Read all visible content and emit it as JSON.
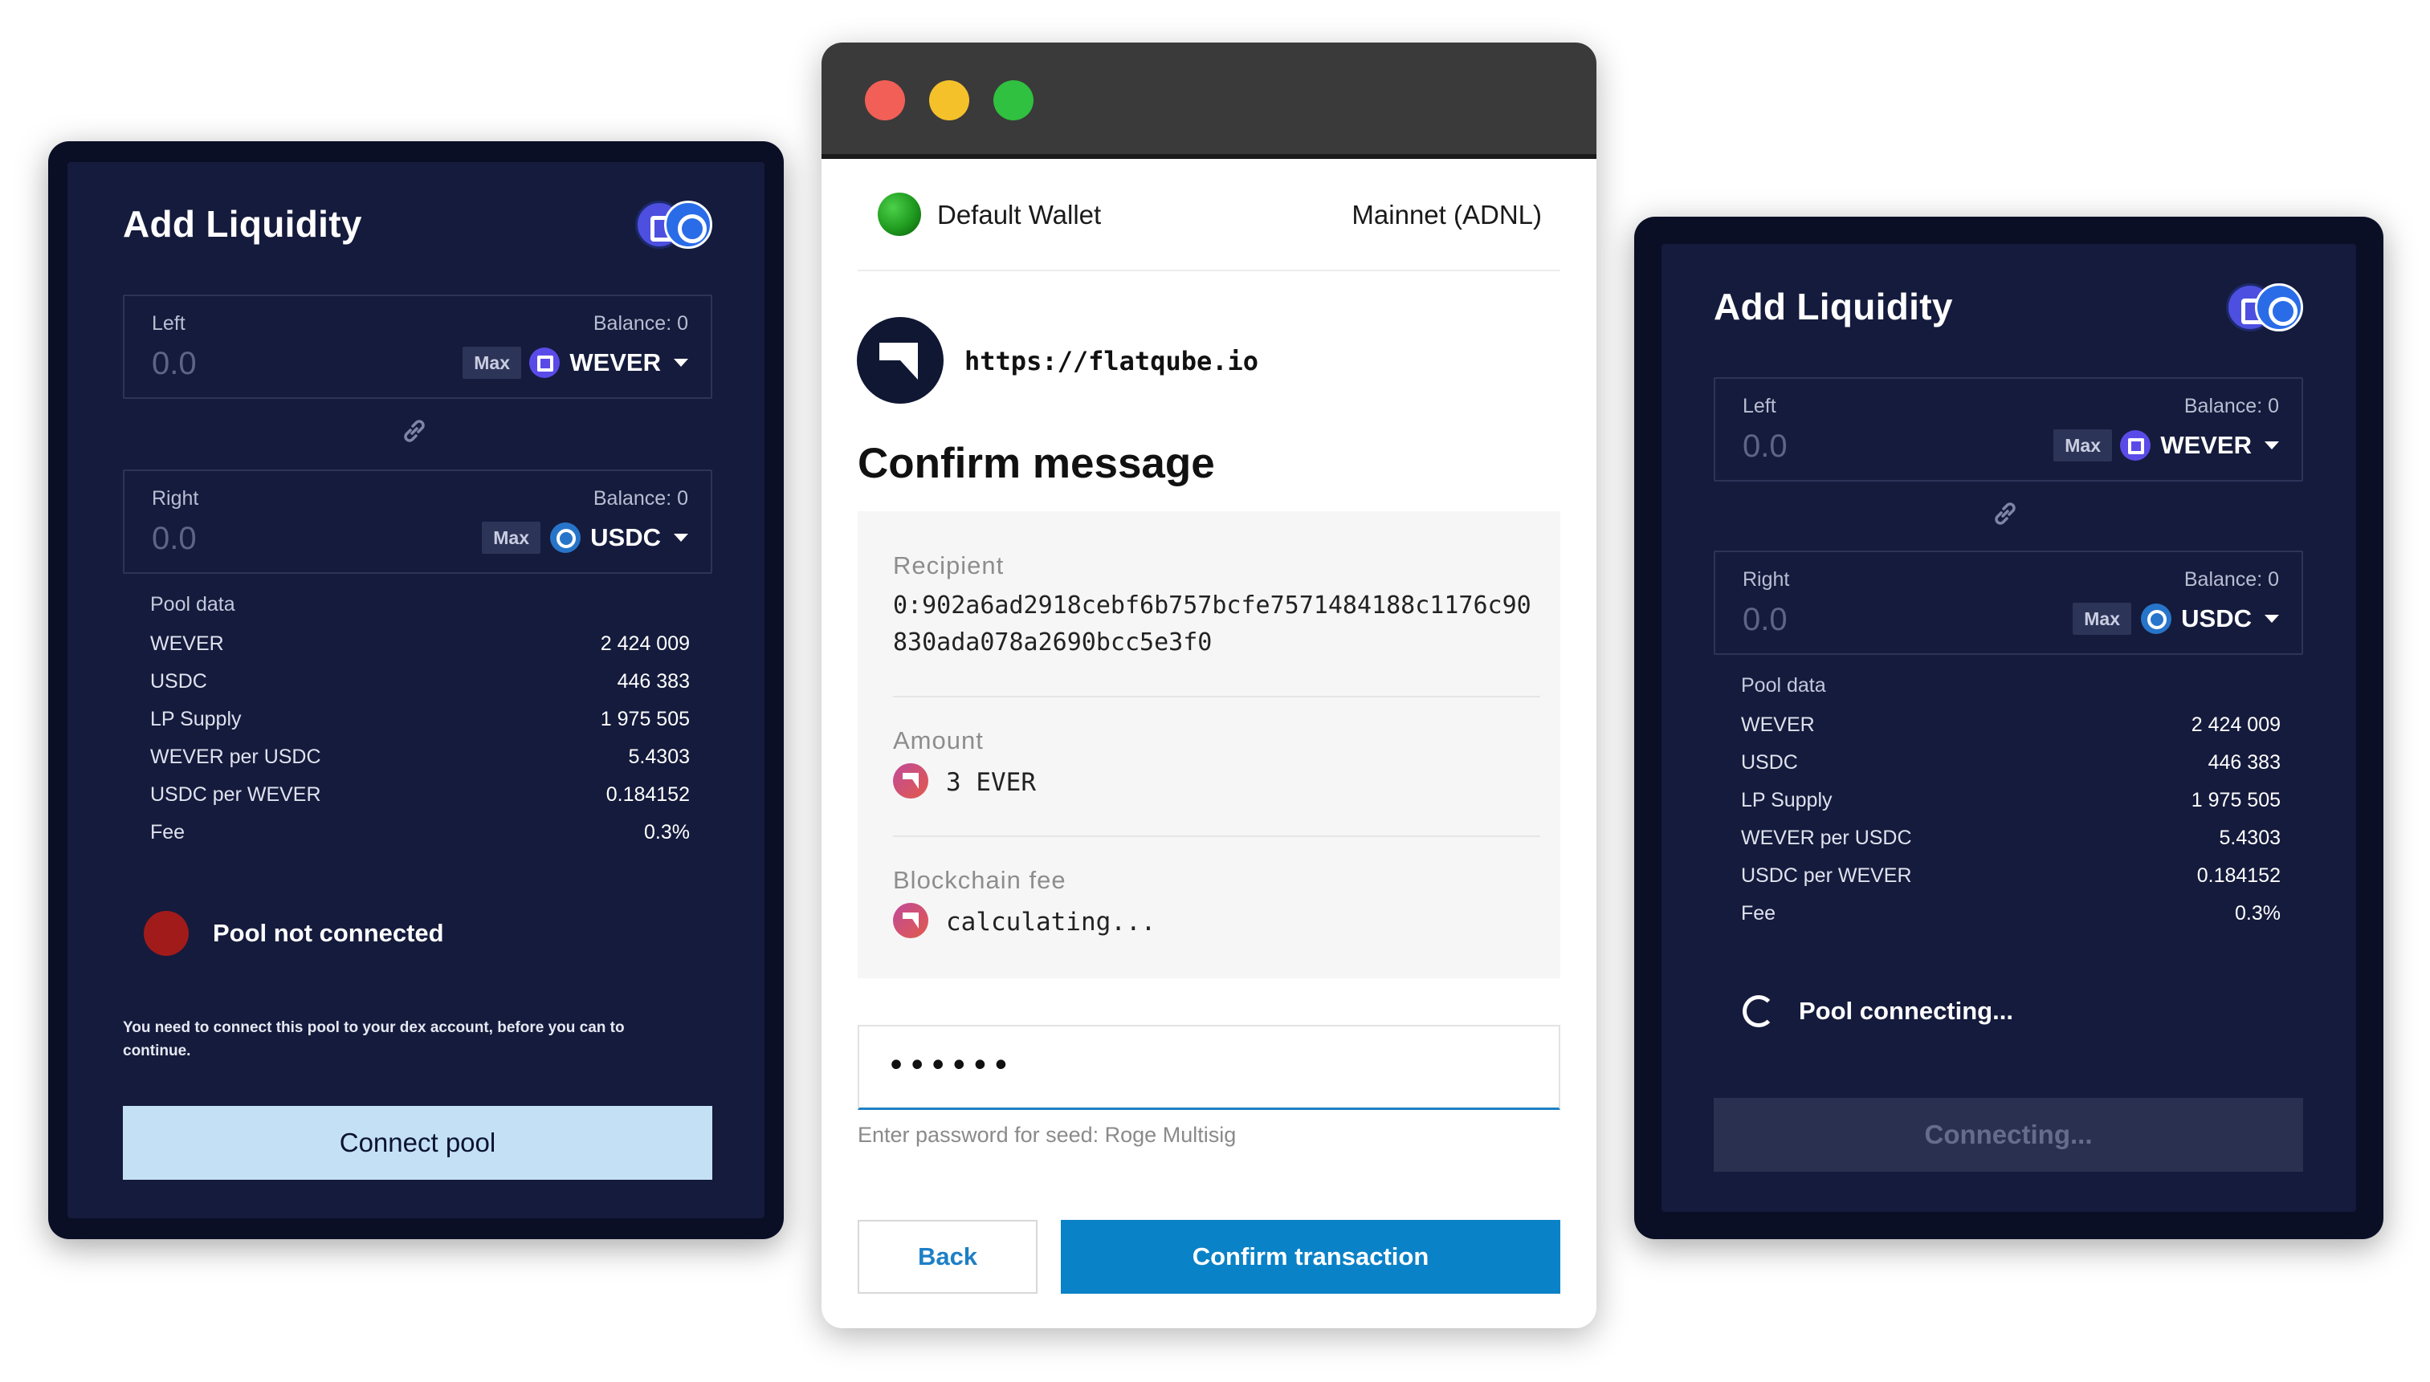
{
  "left_card": {
    "title": "Add Liquidity",
    "left_field": {
      "label": "Left",
      "balance": "Balance: 0",
      "amount": "0.0",
      "max_label": "Max",
      "token": "WEVER",
      "token_icon": "wever-icon"
    },
    "right_field": {
      "label": "Right",
      "balance": "Balance: 0",
      "amount": "0.0",
      "max_label": "Max",
      "token": "USDC",
      "token_icon": "usdc-icon"
    },
    "pool_data": {
      "title": "Pool data",
      "rows": [
        {
          "label": "WEVER",
          "value": "2 424 009"
        },
        {
          "label": "USDC",
          "value": "446 383"
        },
        {
          "label": "LP Supply",
          "value": "1 975 505"
        },
        {
          "label": "WEVER per USDC",
          "value": "5.4303"
        },
        {
          "label": "USDC per WEVER",
          "value": "0.184152"
        },
        {
          "label": "Fee",
          "value": "0.3%"
        }
      ]
    },
    "status": "Pool not connected",
    "status_color": "#a11b1b",
    "note": "You need to connect this pool to your dex account, before you can to continue.",
    "button": "Connect pool"
  },
  "wallet": {
    "traffic_lights": [
      "#f25f57",
      "#f5c12b",
      "#2fc13f"
    ],
    "wallet_name": "Default Wallet",
    "network": "Mainnet (ADNL)",
    "site_url": "https://flatqube.io",
    "title": "Confirm message",
    "recipient_label": "Recipient",
    "recipient_line1": "0:902a6ad2918cebf6b757bcfe7571484188c1176c90",
    "recipient_line2": "830ada078a2690bcc5e3f0",
    "amount_label": "Amount",
    "amount_value": "3 EVER",
    "fee_label": "Blockchain fee",
    "fee_value": "calculating...",
    "password_value": "••••••",
    "password_hint": "Enter password for seed: Roge Multisig",
    "back_button": "Back",
    "confirm_button": "Confirm transaction",
    "accent": "#0a82c8"
  },
  "right_card": {
    "title": "Add Liquidity",
    "left_field": {
      "label": "Left",
      "balance": "Balance: 0",
      "amount": "0.0",
      "max_label": "Max",
      "token": "WEVER",
      "token_icon": "wever-icon"
    },
    "right_field": {
      "label": "Right",
      "balance": "Balance: 0",
      "amount": "0.0",
      "max_label": "Max",
      "token": "USDC",
      "token_icon": "usdc-icon"
    },
    "pool_data": {
      "title": "Pool data",
      "rows": [
        {
          "label": "WEVER",
          "value": "2 424 009"
        },
        {
          "label": "USDC",
          "value": "446 383"
        },
        {
          "label": "LP Supply",
          "value": "1 975 505"
        },
        {
          "label": "WEVER per USDC",
          "value": "5.4303"
        },
        {
          "label": "USDC per WEVER",
          "value": "0.184152"
        },
        {
          "label": "Fee",
          "value": "0.3%"
        }
      ]
    },
    "status": "Pool connecting...",
    "button": "Connecting..."
  }
}
